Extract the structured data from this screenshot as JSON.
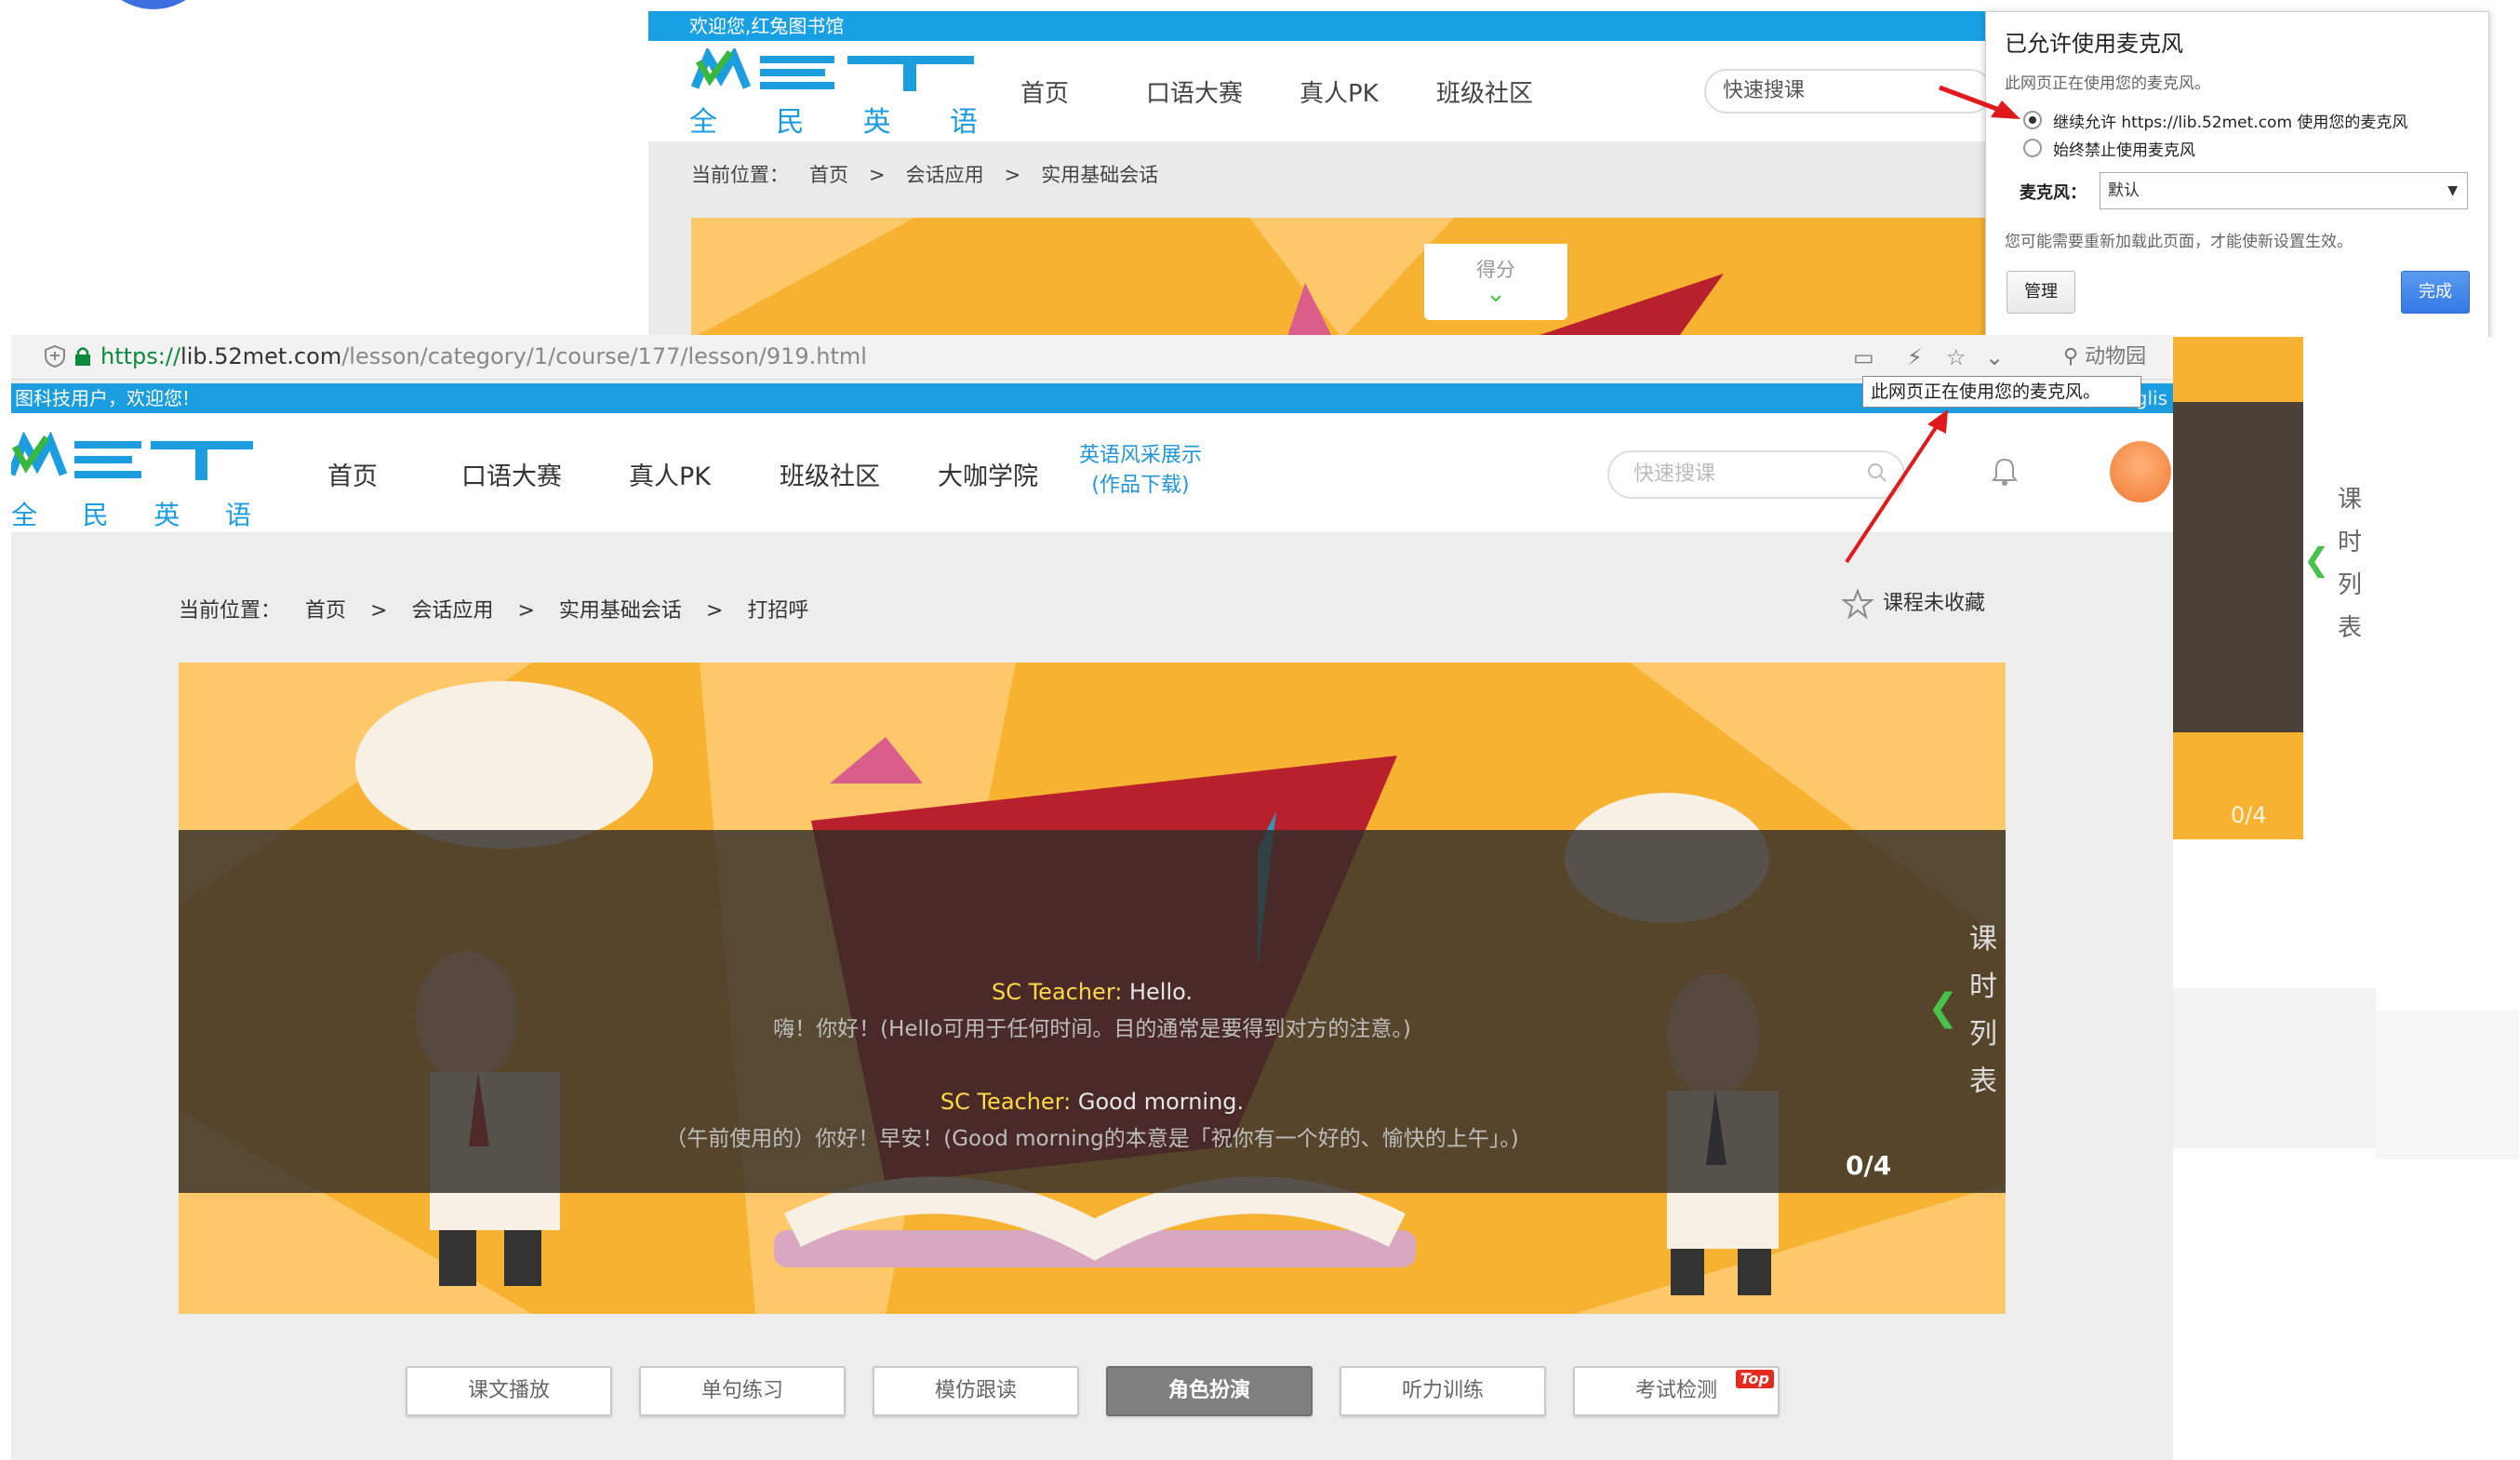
{
  "top_shot": {
    "welcome": "欢迎您,红兔图书馆",
    "logo_sub": [
      "全",
      "民",
      "英",
      "语"
    ],
    "nav": [
      "首页",
      "口语大赛",
      "真人PK",
      "班级社区"
    ],
    "search_placeholder": "快速搜课",
    "breadcrumb": [
      "当前位置：",
      "首页",
      ">",
      "会话应用",
      ">",
      "实用基础会话"
    ],
    "score_label": "得分"
  },
  "mic_popup": {
    "title": "已允许使用麦克风",
    "desc": "此网页正在使用您的麦克风。",
    "option_allow": "继续允许 https://lib.52met.com 使用您的麦克风",
    "option_block": "始终禁止使用麦克风",
    "mic_label": "麦克风：",
    "mic_value": "默认",
    "note": "您可能需要重新加载此页面，才能使新设置生效。",
    "manage": "管理",
    "done": "完成"
  },
  "browser": {
    "url_scheme": "https://",
    "url_domain": "lib.52met.com",
    "url_path": "/lesson/category/1/course/177/lesson/919.html",
    "right_search": "动物园",
    "tooltip": "此网页正在使用您的麦克风。"
  },
  "main": {
    "welcome": "图科技用户，欢迎您!",
    "welcome_right": "中文  Englis",
    "logo_sub": [
      "全",
      "民",
      "英",
      "语"
    ],
    "nav": [
      "首页",
      "口语大赛",
      "真人PK",
      "班级社区",
      "大咖学院"
    ],
    "nav_special_line1": "英语风采展示",
    "nav_special_line2": "(作品下载)",
    "search_placeholder": "快速搜课",
    "breadcrumb": [
      "当前位置：",
      "首页",
      ">",
      "会话应用",
      ">",
      "实用基础会话",
      ">",
      "打招呼"
    ],
    "favorite": "课程未收藏",
    "dialogue": [
      {
        "speaker": "SC Teacher:",
        "en": " Hello.",
        "cn": "嗨！你好！(Hello可用于任何时间。目的通常是要得到对方的注意。)"
      },
      {
        "speaker": "SC Teacher:",
        "en": " Good morning.",
        "cn": "（午前使用的）你好！早安！(Good morning的本意是「祝你有一个好的、愉快的上午」。)"
      }
    ],
    "progress": "0/4",
    "side_label": [
      "课",
      "时",
      "列",
      "表"
    ],
    "tabs": [
      "课文播放",
      "单句练习",
      "模仿跟读",
      "角色扮演",
      "听力训练",
      "考试检测"
    ],
    "active_tab": 3,
    "top_badge": "Top"
  },
  "right_remnant": {
    "progress": "0/4",
    "side_label": [
      "课",
      "时",
      "列",
      "表"
    ]
  },
  "colors": {
    "accent_blue": "#1c9ddf",
    "banner_orange": "#f7b232",
    "logo_green": "#38b73c",
    "arrow_red": "#e0191b"
  }
}
